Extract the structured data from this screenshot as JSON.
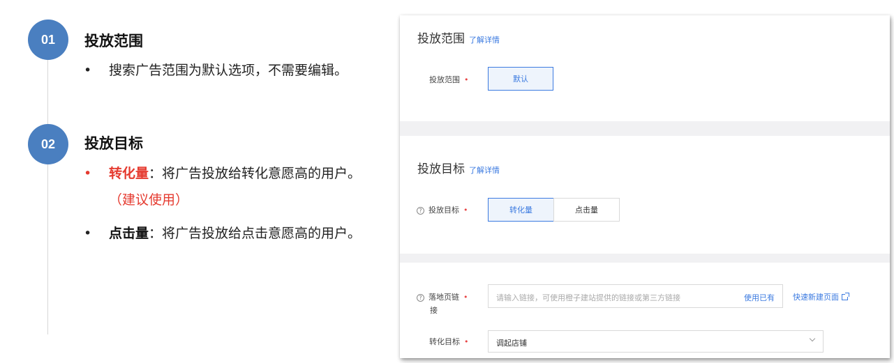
{
  "left": {
    "steps": [
      {
        "number": "01",
        "title": "投放范围",
        "bullets": [
          {
            "bullet": "•",
            "text": "搜索广告范围为默认选项，不需要编辑。"
          }
        ]
      },
      {
        "number": "02",
        "title": "投放目标",
        "bullets": [
          {
            "bullet": "•",
            "strong": "转化量",
            "text": "：将广告投放给转化意愿高的用户。",
            "note": "（建议使用）"
          },
          {
            "bullet": "•",
            "strong": "点击量",
            "text": "：将广告投放给点击意愿高的用户。"
          }
        ]
      }
    ]
  },
  "panel": {
    "scope": {
      "title": "投放范围",
      "link": "了解详情",
      "label": "投放范围",
      "required": "•",
      "option": "默认"
    },
    "goal": {
      "title": "投放目标",
      "link": "了解详情",
      "help": "?",
      "label": "投放目标",
      "required": "•",
      "options": [
        "转化量",
        "点击量"
      ]
    },
    "landing": {
      "help": "?",
      "label_line1": "落地页链",
      "label_line2": "接",
      "required": "•",
      "placeholder": "请输入链接，可使用橙子建站提供的链接或第三方链接",
      "use_existing": "使用已有",
      "quick_create": "快速新建页面"
    },
    "conversion": {
      "label": "转化目标",
      "required": "•",
      "value": "调起店铺"
    }
  },
  "colors": {
    "badge": "#4a7fc0",
    "accent_red": "#e53a2f",
    "link_blue": "#3b7ae0"
  }
}
